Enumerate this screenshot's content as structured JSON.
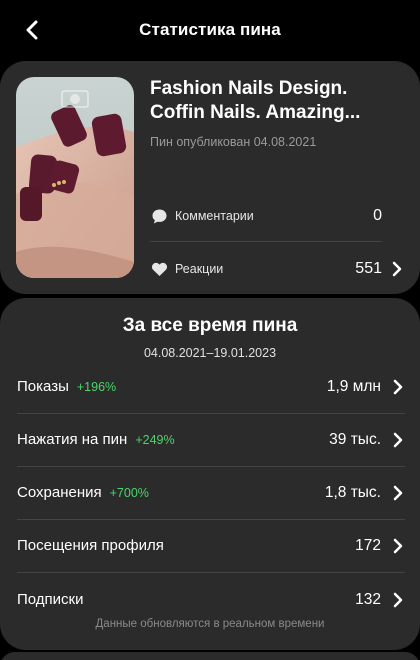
{
  "header": {
    "title": "Статистика пина"
  },
  "pin": {
    "title": "Fashion Nails Design. Coffin Nails. Amazing...",
    "published": "Пин опубликован 04.08.2021",
    "comments_label": "Комментарии",
    "comments_value": "0",
    "reactions_label": "Реакции",
    "reactions_value": "551"
  },
  "lifetime": {
    "title": "За все время пина",
    "range": "04.08.2021–19.01.2023",
    "rows": [
      {
        "label": "Показы",
        "delta": "+196%",
        "value": "1,9 млн"
      },
      {
        "label": "Нажатия на пин",
        "delta": "+249%",
        "value": "39 тыс."
      },
      {
        "label": "Сохранения",
        "delta": "+700%",
        "value": "1,8 тыс."
      },
      {
        "label": "Посещения профиля",
        "delta": "",
        "value": "172"
      },
      {
        "label": "Подписки",
        "delta": "",
        "value": "132"
      }
    ],
    "footnote": "Данные обновляются в реальном времени"
  },
  "colors": {
    "background": "#000000",
    "card": "#2b2b2b",
    "positive": "#4cd36a",
    "muted": "#9a9a9a"
  }
}
